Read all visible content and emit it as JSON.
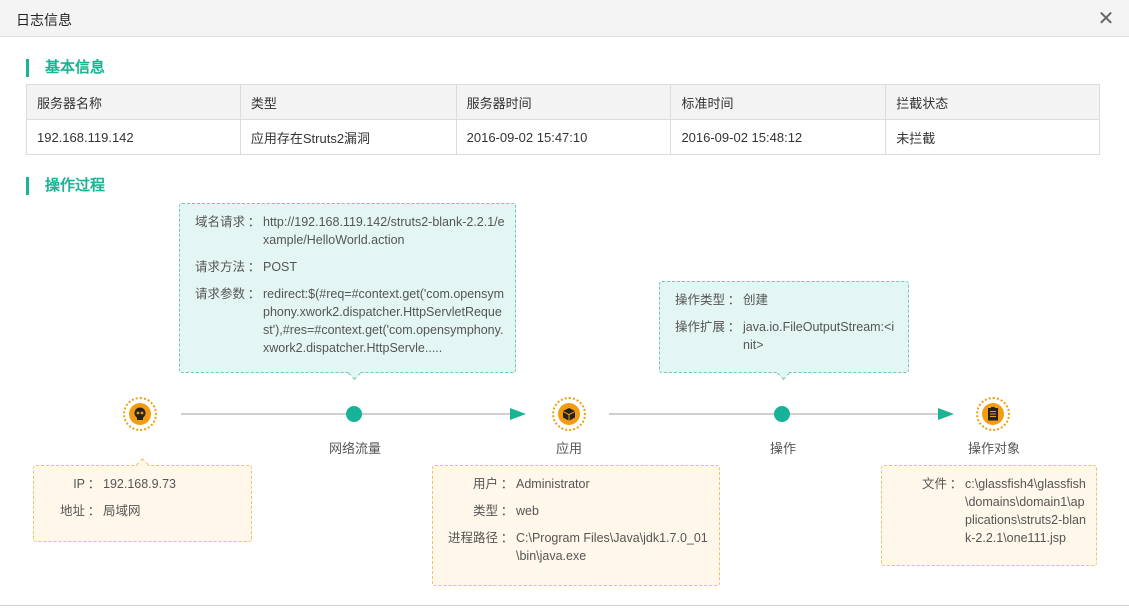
{
  "dialog": {
    "title": "日志信息",
    "close_glyph": "✕"
  },
  "basic_info": {
    "heading": "基本信息",
    "columns": [
      "服务器名称",
      "类型",
      "服务器时间",
      "标准时间",
      "拦截状态"
    ],
    "row": [
      "192.168.119.142",
      "应用存在Struts2漏洞",
      "2016-09-02 15:47:10",
      "2016-09-02 15:48:12",
      "未拦截"
    ]
  },
  "process": {
    "heading": "操作过程",
    "request_bubble": {
      "rows": [
        {
          "key": "域名请求",
          "value": "http://192.168.119.142/struts2-blank-2.2.1/example/HelloWorld.action"
        },
        {
          "key": "请求方法",
          "value": "POST"
        },
        {
          "key": "请求参数",
          "value": "redirect:$(#req=#context.get('com.opensymphony.xwork2.dispatcher.HttpServletRequest'),#res=#context.get('com.opensymphony.xwork2.dispatcher.HttpServle....."
        }
      ]
    },
    "operation_bubble": {
      "rows": [
        {
          "key": "操作类型",
          "value": "创建"
        },
        {
          "key": "操作扩展",
          "value": "java.io.FileOutputStream:<init>"
        }
      ]
    },
    "source_bubble": {
      "rows": [
        {
          "key": "IP",
          "value": "192.168.9.73"
        },
        {
          "key": "地址",
          "value": "局域网"
        }
      ]
    },
    "app_bubble": {
      "rows": [
        {
          "key": "用户",
          "value": "Administrator"
        },
        {
          "key": "类型",
          "value": "web"
        },
        {
          "key": "进程路径",
          "value": "C:\\Program Files\\Java\\jdk1.7.0_01\\bin\\java.exe"
        }
      ]
    },
    "target_bubble": {
      "rows": [
        {
          "key": "文件",
          "value": "c:\\glassfish4\\glassfish\\domains\\domain1\\applications\\struts2-blank-2.2.1\\one111.jsp"
        }
      ]
    },
    "flow_labels": {
      "network": "网络流量",
      "app": "应用",
      "operation": "操作",
      "target": "操作对象"
    },
    "icons": {
      "source": "skull-icon",
      "app": "package-icon",
      "target": "clipboard-icon"
    },
    "colors": {
      "accent": "#1ab394",
      "node": "#f39c12"
    }
  },
  "sep": "："
}
